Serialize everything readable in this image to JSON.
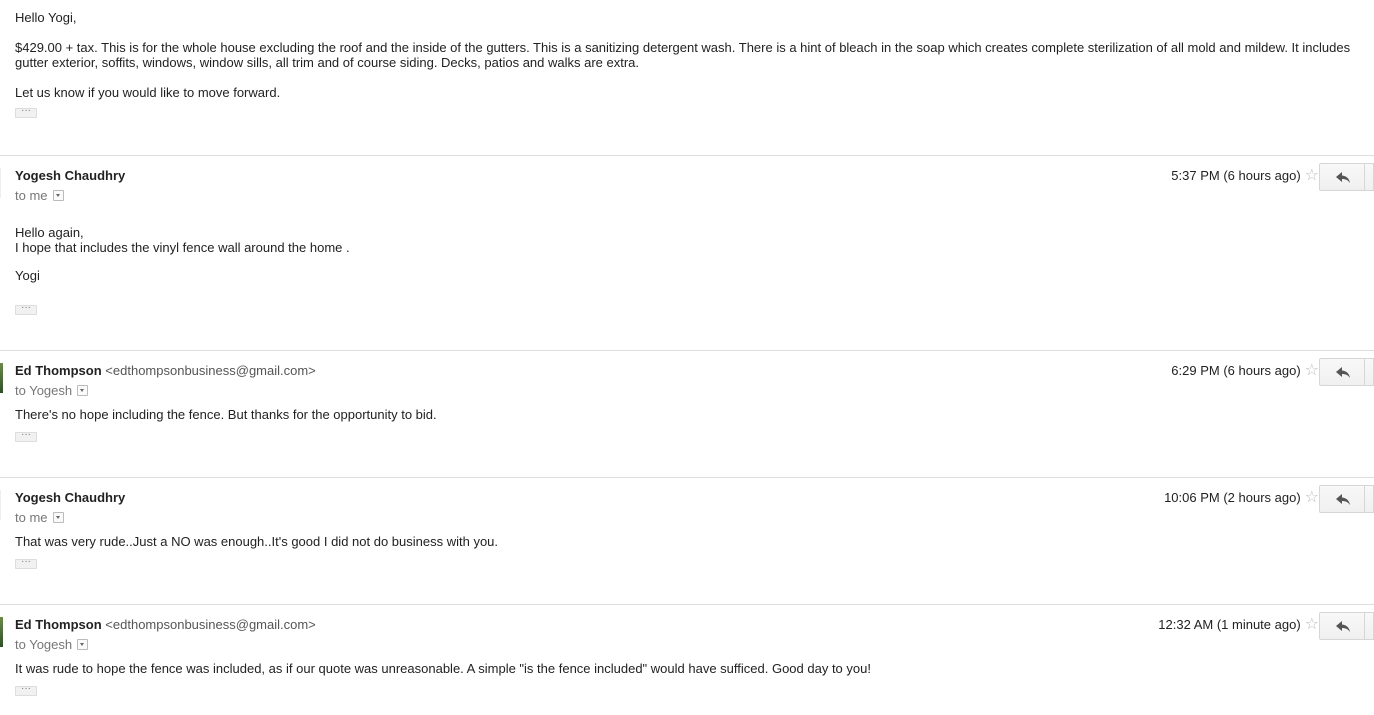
{
  "first_message": {
    "greeting": "Hello Yogi,",
    "paragraph": "$429.00 + tax.  This is for the whole house excluding the roof and the inside of the gutters.  This is a sanitizing detergent wash.  There is a hint of bleach in the soap which creates complete sterilization of all mold and mildew.  It includes gutter exterior, soffits, windows, window sills, all trim and of course siding.  Decks, patios and walks are extra.",
    "closing": "Let us know if you would like to move forward.",
    "ellipsis": "···"
  },
  "messages": [
    {
      "sender_name": "Yogesh Chaudhry",
      "sender_email": "",
      "to": "to me",
      "time": "5:37 PM (6 hours ago)",
      "star": "☆",
      "body_lines": [
        "Hello again,",
        "I hope that includes the vinyl fence wall around the home .",
        "",
        "Yogi"
      ],
      "ellipsis": "···"
    },
    {
      "sender_name": "Ed Thompson",
      "sender_email": "<edthompsonbusiness@gmail.com>",
      "to": "to Yogesh",
      "time": "6:29 PM (6 hours ago)",
      "star": "☆",
      "body_lines": [
        "There's no hope including the fence.  But thanks for the opportunity to bid."
      ],
      "ellipsis": "···"
    },
    {
      "sender_name": "Yogesh Chaudhry",
      "sender_email": "",
      "to": "to me",
      "time": "10:06 PM (2 hours ago)",
      "star": "☆",
      "body_lines": [
        "That was very rude..Just a NO was enough..It's good I did not do business with you."
      ],
      "ellipsis": "···"
    },
    {
      "sender_name": "Ed Thompson",
      "sender_email": "<edthompsonbusiness@gmail.com>",
      "to": "to Yogesh",
      "time": "12:32 AM (1 minute ago)",
      "star": "☆",
      "body_lines": [
        "It was rude to hope the fence was included, as if our quote was unreasonable.  A simple \"is the fence included\" would have sufficed.  Good day to you!"
      ],
      "ellipsis": "···"
    }
  ],
  "icons": {
    "reply": "reply-icon",
    "star": "star-icon",
    "dropdown": "chevron-down-icon"
  }
}
